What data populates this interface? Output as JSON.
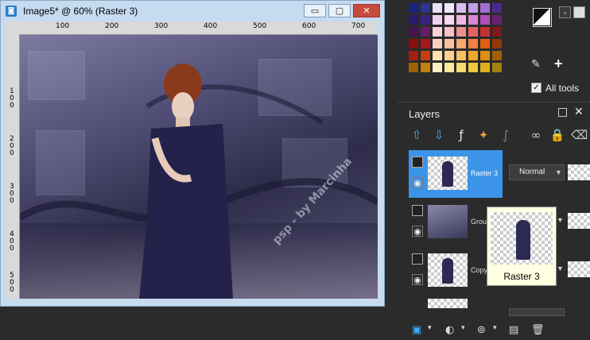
{
  "window": {
    "title": "Image5* @  60% (Raster 3)",
    "app_icon": "psp-image-icon",
    "controls": {
      "minimize": "▭",
      "maximize": "▢",
      "close": "✕"
    }
  },
  "rulers": {
    "top_labels": [
      "100",
      "200",
      "300",
      "400",
      "500",
      "600",
      "700"
    ],
    "left_labels": [
      "1 0 0",
      "2 0 0",
      "3 0 0",
      "4 0 0",
      "5 0 0"
    ]
  },
  "watermark": "psp - by Marcinha",
  "palette": {
    "all_tools_label": "All tools",
    "all_tools_checked": true,
    "colors_accent": [
      "#3b1a7a",
      "#8a3db8",
      "#e0b0e8",
      "#f5c0c0",
      "#f04040",
      "#ff9020",
      "#ffb830"
    ]
  },
  "layers": {
    "title": "Layers",
    "blend_mode": "Normal",
    "rows": [
      {
        "name": "Raster 3",
        "selected": true
      },
      {
        "name": "Group",
        "selected": false
      },
      {
        "name": "Copy",
        "selected": false
      }
    ],
    "tooltip_label": "Raster 3"
  }
}
